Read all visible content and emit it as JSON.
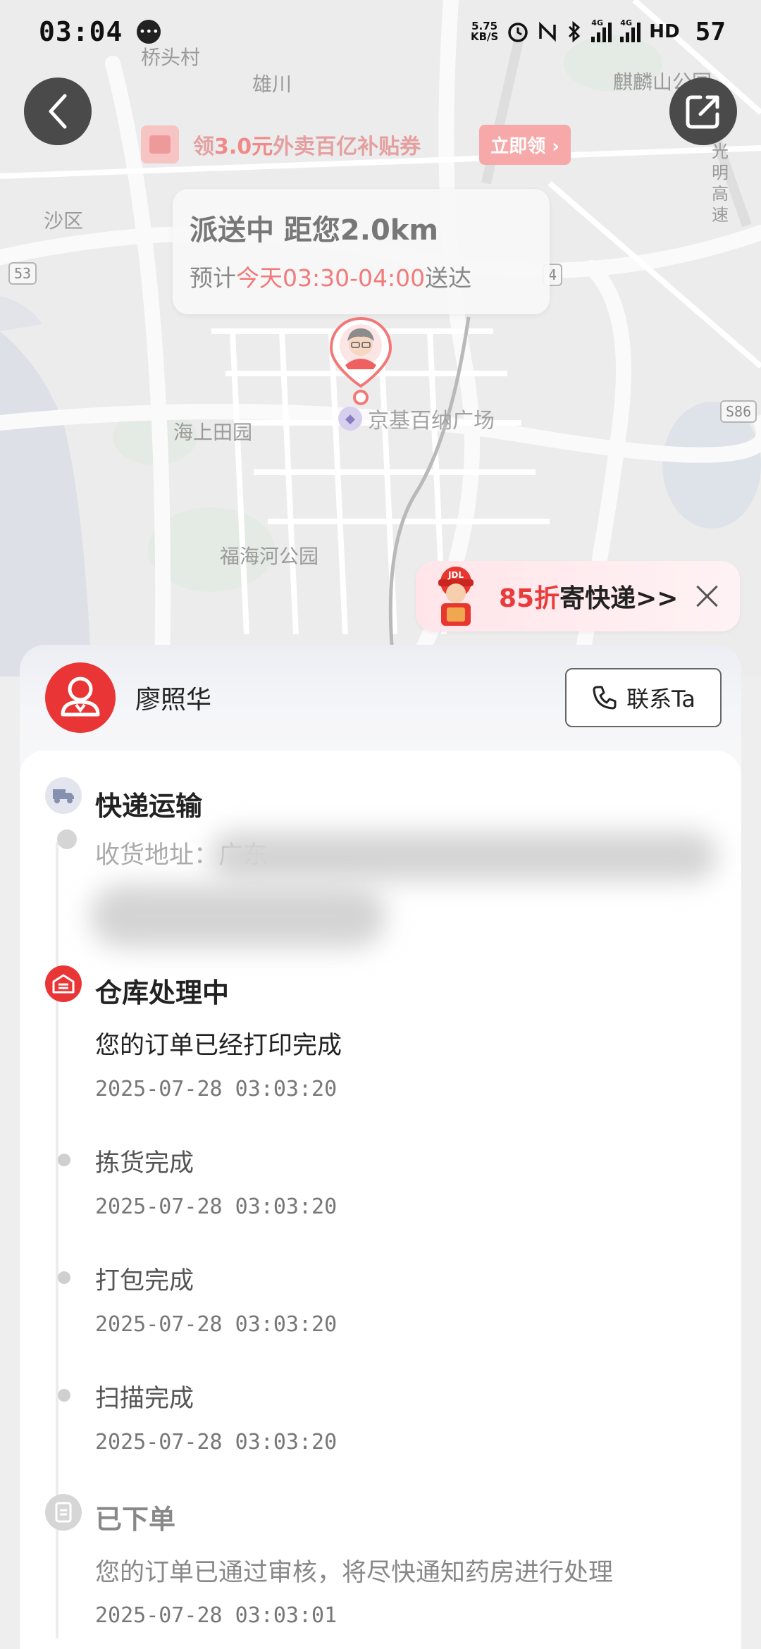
{
  "status_bar": {
    "time": "03:04",
    "net_speed_value": "5.75",
    "net_speed_unit": "KB/S",
    "network_1": "4G",
    "network_2": "4G",
    "hd": "HD",
    "battery": "57"
  },
  "map": {
    "labels": {
      "qiaotoucun": "桥头村",
      "xiongchuan": "雄川",
      "qilingshan": "麒麟山公园",
      "shaqu": "沙区",
      "haishangtianyuan": "海上田园",
      "fuhaihe": "福海河公园",
      "jingji_mall": "京基百纳广场",
      "guangming_hw": "光明高速"
    },
    "road_badges": [
      "53",
      "S86",
      "4"
    ]
  },
  "coupon_banner": {
    "prefix": "领",
    "amount": "3.0元",
    "suffix": "外卖百亿补贴券",
    "claim_label": "立即领 ›"
  },
  "delivery": {
    "status": "派送中 距您2.0km",
    "eta_prefix": "预计",
    "eta_window": "今天03:30-04:00",
    "eta_suffix": "送达"
  },
  "promo": {
    "discount": "85折",
    "text": "寄快递>>",
    "mascot_badge": "JDL"
  },
  "courier": {
    "name": "廖照华",
    "contact_label": "联系Ta"
  },
  "tracking": {
    "transport_title": "快递运输",
    "address_label": "收货地址：广东",
    "events": [
      {
        "title": "仓库处理中",
        "desc": "您的订单已经打印完成",
        "time": "2025-07-28 03:03:20"
      },
      {
        "title": "拣货完成",
        "time": "2025-07-28 03:03:20"
      },
      {
        "title": "打包完成",
        "time": "2025-07-28 03:03:20"
      },
      {
        "title": "扫描完成",
        "time": "2025-07-28 03:03:20"
      },
      {
        "title": "已下单",
        "desc": "您的订单已通过审核，将尽快通知药房进行处理",
        "time": "2025-07-28 03:03:01"
      }
    ]
  },
  "colors": {
    "accent_red": "#e93535",
    "map_bg": "#ececec",
    "road": "#ffffff"
  }
}
